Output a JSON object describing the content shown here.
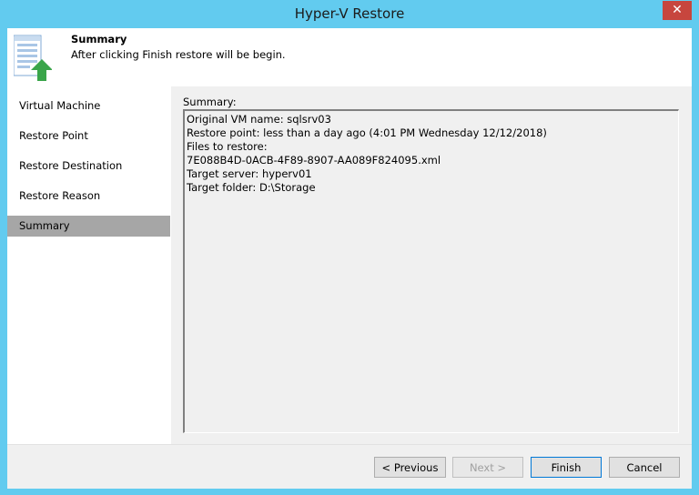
{
  "window": {
    "title": "Hyper-V Restore",
    "close_glyph": "✕"
  },
  "header": {
    "title": "Summary",
    "description": "After clicking Finish restore will be begin.",
    "icon": "restore-document-icon",
    "icon_arrow_color": "#3aa54a"
  },
  "steps": [
    {
      "label": "Virtual Machine"
    },
    {
      "label": "Restore Point"
    },
    {
      "label": "Restore Destination"
    },
    {
      "label": "Restore Reason"
    },
    {
      "label": "Summary",
      "active": true
    }
  ],
  "summary": {
    "label": "Summary:",
    "lines": [
      "Original VM name: sqlsrv03",
      "Restore point: less than a day ago (4:01 PM Wednesday 12/12/2018)",
      "Files to restore:",
      "7E088B4D-0ACB-4F89-8907-AA089F824095.xml",
      "Target server: hyperv01",
      "Target folder: D:\\Storage"
    ]
  },
  "buttons": {
    "previous": "< Previous",
    "next": "Next >",
    "finish": "Finish",
    "cancel": "Cancel"
  },
  "colors": {
    "title_bar": "#62cbef",
    "close_button": "#c7463e",
    "active_step": "#a6a6a6"
  }
}
